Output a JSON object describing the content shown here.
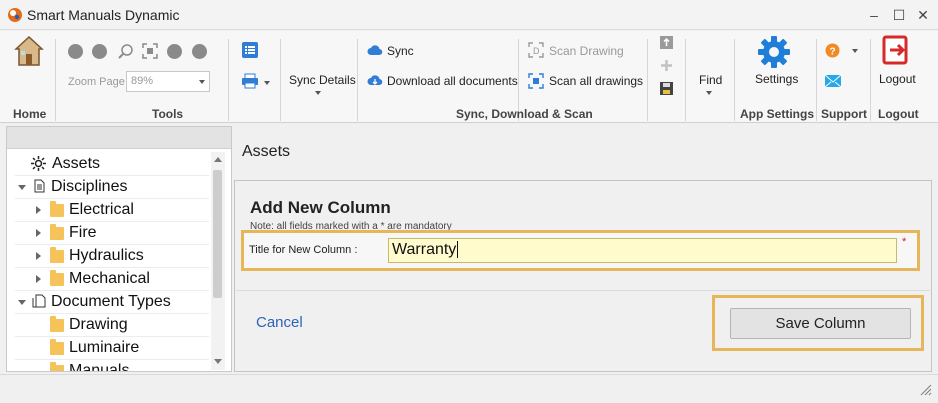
{
  "window": {
    "title": "Smart Manuals Dynamic",
    "controls": {
      "minimize": "–",
      "maximize": "☐",
      "close": "✕"
    }
  },
  "ribbon": {
    "home": {
      "label": "Home",
      "icon": "house-icon"
    },
    "tools": {
      "label": "Tools",
      "zoom_label": "Zoom Page",
      "zoom_value": "89%",
      "icons": [
        "back-circle-icon",
        "forward-circle-icon",
        "zoom-search-icon",
        "fit-page-icon",
        "zoom-in-icon",
        "zoom-out-icon",
        "list-icon",
        "print-icon"
      ]
    },
    "sync_details": {
      "label": "Sync Details"
    },
    "sync_group": {
      "label": "Sync, Download & Scan",
      "sync": "Sync",
      "download_all": "Download all documents",
      "scan_drawing": "Scan Drawing",
      "scan_all": "Scan all drawings"
    },
    "find": {
      "label": "Find"
    },
    "app_settings": {
      "label": "App Settings",
      "button": "Settings"
    },
    "support": {
      "label": "Support"
    },
    "logout": {
      "label": "Logout",
      "button": "Logout"
    }
  },
  "tree": {
    "items": [
      {
        "label": "Assets",
        "level": 0,
        "icon": "asset-gear-icon"
      },
      {
        "label": "Disciplines",
        "level": 0,
        "expanded": true
      },
      {
        "label": "Electrical",
        "level": 1
      },
      {
        "label": "Fire",
        "level": 1
      },
      {
        "label": "Hydraulics",
        "level": 1
      },
      {
        "label": "Mechanical",
        "level": 1
      },
      {
        "label": "Document Types",
        "level": 0,
        "expanded": true
      },
      {
        "label": "Drawing",
        "level": 1
      },
      {
        "label": "Luminaire",
        "level": 1
      },
      {
        "label": "Manuals",
        "level": 1,
        "partial": true
      }
    ]
  },
  "main": {
    "section_title": "Assets",
    "form": {
      "heading": "Add New Column",
      "note": "Note: all fields marked with a * are mandatory",
      "field_label": "Title for New Column :",
      "field_value": "Warranty",
      "required_marker": "*",
      "cancel": "Cancel",
      "save": "Save Column"
    }
  },
  "colors": {
    "highlight": "#e7b65b",
    "link": "#2d62b8",
    "input_bg": "#fffbcc",
    "settings_blue": "#1f7fd8",
    "logout_red": "#d62a2a"
  }
}
